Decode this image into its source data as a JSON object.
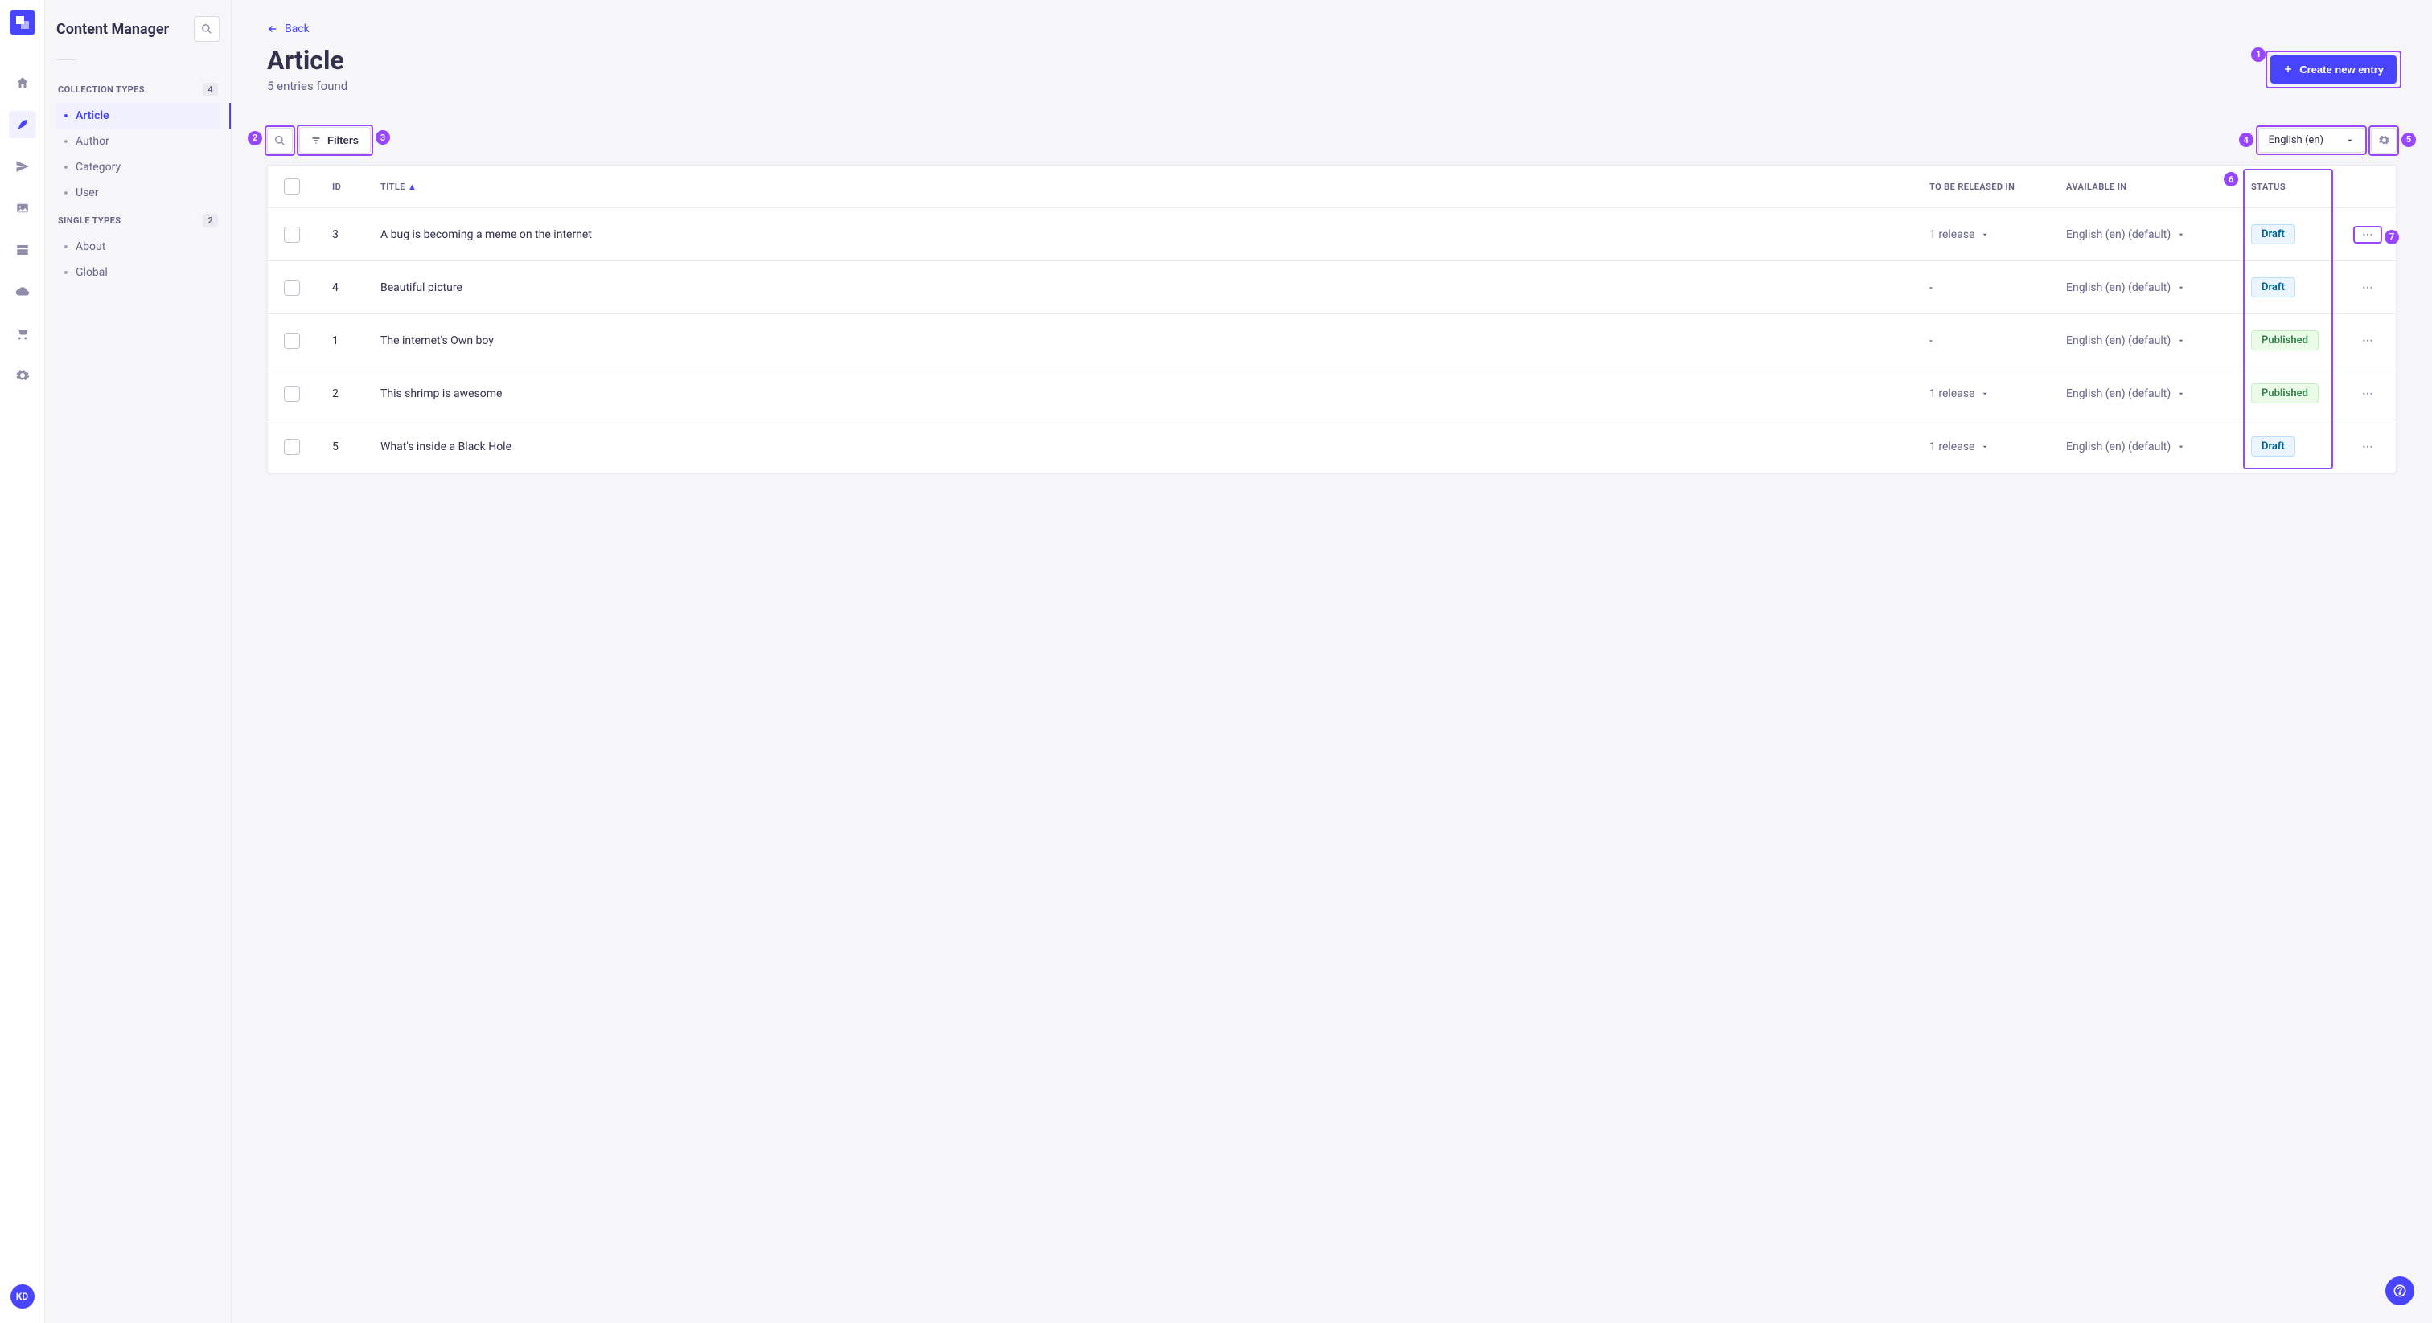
{
  "rail": {
    "avatar": "KD"
  },
  "sidebar": {
    "title": "Content Manager",
    "collection_types_label": "COLLECTION TYPES",
    "collection_types_count": "4",
    "single_types_label": "SINGLE TYPES",
    "single_types_count": "2",
    "collection_items": [
      {
        "label": "Article"
      },
      {
        "label": "Author"
      },
      {
        "label": "Category"
      },
      {
        "label": "User"
      }
    ],
    "single_items": [
      {
        "label": "About"
      },
      {
        "label": "Global"
      }
    ]
  },
  "page": {
    "back_label": "Back",
    "title": "Article",
    "subtitle": "5 entries found",
    "create_label": "Create new entry",
    "filters_label": "Filters",
    "locale_selected": "English (en)"
  },
  "table": {
    "columns": {
      "id": "ID",
      "title": "TITLE",
      "to_be_released": "TO BE RELEASED IN",
      "available_in": "AVAILABLE IN",
      "status": "STATUS"
    },
    "rows": [
      {
        "id": "3",
        "title": "A bug is becoming a meme on the internet",
        "release": "1 release",
        "available": "English (en) (default)",
        "status": "Draft"
      },
      {
        "id": "4",
        "title": "Beautiful picture",
        "release": "-",
        "available": "English (en) (default)",
        "status": "Draft"
      },
      {
        "id": "1",
        "title": "The internet's Own boy",
        "release": "-",
        "available": "English (en) (default)",
        "status": "Published"
      },
      {
        "id": "2",
        "title": "This shrimp is awesome",
        "release": "1 release",
        "available": "English (en) (default)",
        "status": "Published"
      },
      {
        "id": "5",
        "title": "What's inside a Black Hole",
        "release": "1 release",
        "available": "English (en) (default)",
        "status": "Draft"
      }
    ]
  },
  "annotations": [
    "1",
    "2",
    "3",
    "4",
    "5",
    "6",
    "7"
  ]
}
